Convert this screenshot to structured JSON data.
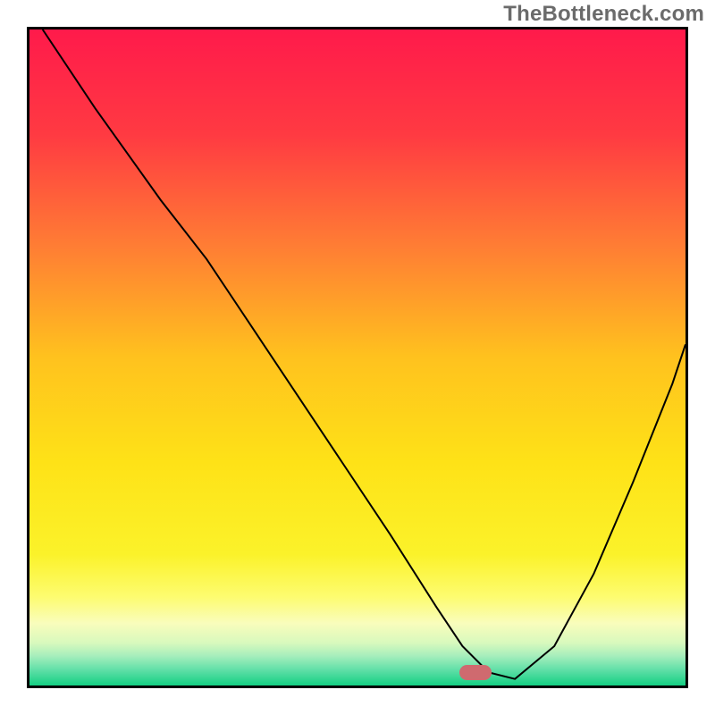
{
  "watermark": {
    "text": "TheBottleneck.com"
  },
  "chart_data": {
    "type": "line",
    "title": "",
    "xlabel": "",
    "ylabel": "",
    "xlim": [
      0,
      100
    ],
    "ylim": [
      0,
      100
    ],
    "grid": false,
    "background_gradient": {
      "stops": [
        {
          "offset": 0.0,
          "color": "#ff1a4b"
        },
        {
          "offset": 0.16,
          "color": "#ff3a42"
        },
        {
          "offset": 0.33,
          "color": "#ff7d34"
        },
        {
          "offset": 0.5,
          "color": "#ffc21e"
        },
        {
          "offset": 0.66,
          "color": "#fee217"
        },
        {
          "offset": 0.8,
          "color": "#fbf22a"
        },
        {
          "offset": 0.865,
          "color": "#fdfc70"
        },
        {
          "offset": 0.905,
          "color": "#f9fdbc"
        },
        {
          "offset": 0.935,
          "color": "#d8f9bd"
        },
        {
          "offset": 0.955,
          "color": "#a6eebc"
        },
        {
          "offset": 0.975,
          "color": "#64e0a9"
        },
        {
          "offset": 1.0,
          "color": "#14cf83"
        }
      ]
    },
    "series": [
      {
        "name": "bottleneck-curve",
        "color": "#000000",
        "stroke_width": 2,
        "x": [
          2,
          10,
          20,
          27,
          35,
          45,
          55,
          62,
          66,
          70,
          74,
          80,
          86,
          92,
          98,
          100
        ],
        "y": [
          100,
          88,
          74,
          65,
          53,
          38,
          23,
          12,
          6,
          2,
          1,
          6,
          17,
          31,
          46,
          52
        ]
      }
    ],
    "marker": {
      "name": "selected-point",
      "x": 68,
      "y": 0.8,
      "width_pct": 5.0,
      "height_pct": 2.4,
      "color": "#cf6a6f"
    }
  }
}
